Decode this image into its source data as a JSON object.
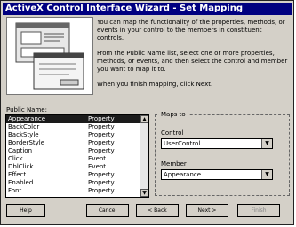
{
  "window": {
    "title": "ActiveX Control Interface Wizard - Set Mapping"
  },
  "intro": {
    "p1": "You can map the functionality of the properties, methods, or events in your control to the members in constituent controls.",
    "p2": "From the Public Name list, select one or more properties, methods, or events, and then select the control and member you want to map it to.",
    "p3": "When you finish mapping, click Next."
  },
  "public_name": {
    "label": "Public Name:",
    "items": [
      {
        "name": "Appearance",
        "type": "Property"
      },
      {
        "name": "BackColor",
        "type": "Property"
      },
      {
        "name": "BackStyle",
        "type": "Property"
      },
      {
        "name": "BorderStyle",
        "type": "Property"
      },
      {
        "name": "Caption",
        "type": "Property"
      },
      {
        "name": "Click",
        "type": "Event"
      },
      {
        "name": "DblClick",
        "type": "Event"
      },
      {
        "name": "Effect",
        "type": "Property"
      },
      {
        "name": "Enabled",
        "type": "Property"
      },
      {
        "name": "Font",
        "type": "Property"
      }
    ]
  },
  "maps_to": {
    "label": "Maps to",
    "control_label": "Control",
    "control_value": "UserControl",
    "member_label": "Member",
    "member_value": "Appearance"
  },
  "buttons": {
    "help": "Help",
    "cancel": "Cancel",
    "back": "< Back",
    "next": "Next >",
    "finish": "Finish"
  },
  "colors": {
    "titlebar": "#000080",
    "selection": "#1a1a1a"
  }
}
